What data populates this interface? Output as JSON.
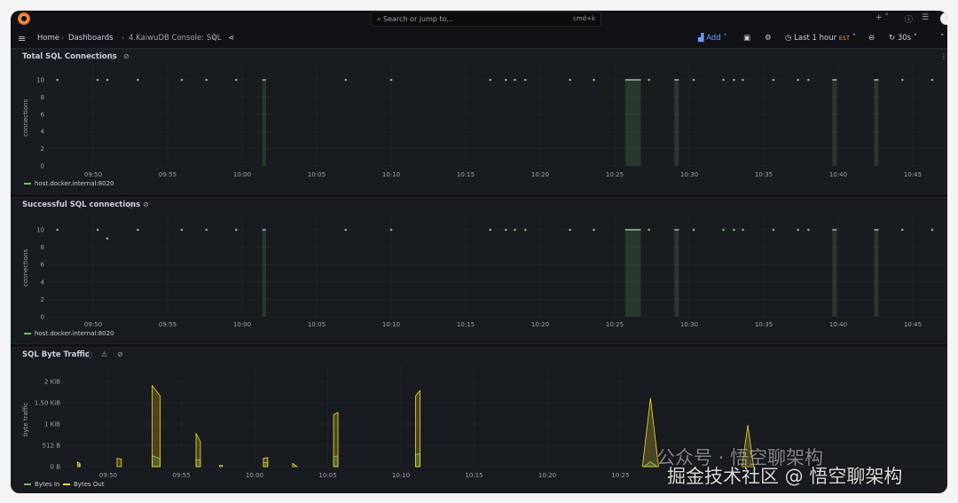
{
  "topbar": {
    "search_placeholder": "Search or jump to...",
    "shortcut": "cmd+k",
    "new_label": "+"
  },
  "breadcrumb": {
    "items": [
      "Home",
      "Dashboards",
      "4.KaiwuDB Console: SQL"
    ]
  },
  "toolbar": {
    "add_label": "Add",
    "time_range": "Last 1 hour",
    "timezone": "EST",
    "refresh": "30s"
  },
  "colors": {
    "bg": "#111217",
    "panel": "#181b1f",
    "series_green": "#73bf69",
    "series_yellow": "#fade2a",
    "timezone": "#f2a33a",
    "add": "#6e9fff"
  },
  "x_ticks": {
    "panel_a": [
      "09:50",
      "09:55",
      "10:00",
      "10:05",
      "10:10",
      "10:15",
      "10:20",
      "10:25",
      "10:30",
      "10:35",
      "10:40",
      "10:45"
    ],
    "panel_c": [
      "09:50",
      "09:55",
      "10:00",
      "10:05",
      "10:10",
      "10:15",
      "10:20",
      "10:25"
    ]
  },
  "panels": [
    {
      "title": "Total SQL Connections",
      "ylabel": "connections",
      "legend": [
        "host.docker.internal:8020"
      ]
    },
    {
      "title": "Successful SQL connections",
      "ylabel": "connections",
      "legend": [
        "host.docker.internal:8020"
      ]
    },
    {
      "title": "SQL Byte Traffic",
      "ylabel": "byte traffic",
      "legend": [
        "Bytes In",
        "Bytes Out"
      ]
    }
  ],
  "chart_data": [
    {
      "type": "scatter",
      "title": "Total SQL Connections",
      "x_unit": "minutes after 09:45",
      "ylabel": "connections",
      "yticks": [
        "0",
        "2",
        "4",
        "6",
        "8",
        "10"
      ],
      "ylim": [
        0,
        10
      ],
      "series": [
        {
          "name": "host.docker.internal:8020",
          "points": [
            [
              2.6,
              10
            ],
            [
              5.3,
              10
            ],
            [
              5.95,
              10
            ],
            [
              8,
              10
            ],
            [
              10.95,
              10
            ],
            [
              12.6,
              10
            ],
            [
              14.6,
              10
            ],
            [
              21.95,
              10
            ],
            [
              25,
              10
            ],
            [
              31.65,
              10
            ],
            [
              32.7,
              10
            ],
            [
              33.3,
              10
            ],
            [
              34,
              10
            ],
            [
              37,
              10
            ],
            [
              38.6,
              10
            ],
            [
              42.3,
              10
            ],
            [
              45.3,
              10
            ],
            [
              47.3,
              10
            ],
            [
              48,
              10
            ],
            [
              48.6,
              10
            ],
            [
              50.65,
              10
            ],
            [
              52.3,
              10
            ],
            [
              53,
              10
            ],
            [
              59.3,
              10
            ],
            [
              61.3,
              10
            ]
          ],
          "bands": [
            [
              16.35,
              16.6
            ],
            [
              40.7,
              41.75
            ],
            [
              44.0,
              44.3
            ],
            [
              54.6,
              54.9
            ],
            [
              57.4,
              57.7
            ]
          ]
        }
      ]
    },
    {
      "type": "scatter",
      "title": "Successful SQL connections",
      "x_unit": "minutes after 09:45",
      "ylabel": "connections",
      "yticks": [
        "0",
        "2",
        "4",
        "6",
        "8",
        "10"
      ],
      "ylim": [
        0,
        10
      ],
      "series": [
        {
          "name": "host.docker.internal:8020",
          "points": [
            [
              2.6,
              10
            ],
            [
              5.3,
              10
            ],
            [
              5.95,
              9
            ],
            [
              8,
              10
            ],
            [
              10.95,
              10
            ],
            [
              12.6,
              10
            ],
            [
              14.6,
              10
            ],
            [
              21.95,
              10
            ],
            [
              25,
              10
            ],
            [
              31.65,
              10
            ],
            [
              32.7,
              10
            ],
            [
              33.3,
              10
            ],
            [
              34,
              10
            ],
            [
              37,
              10
            ],
            [
              38.6,
              10
            ],
            [
              42.3,
              10
            ],
            [
              45.3,
              10
            ],
            [
              47.3,
              10
            ],
            [
              48,
              10
            ],
            [
              48.6,
              10
            ],
            [
              50.65,
              10
            ],
            [
              52.3,
              10
            ],
            [
              53,
              10
            ],
            [
              59.3,
              10
            ],
            [
              61.3,
              10
            ]
          ],
          "bands": [
            [
              16.35,
              16.6
            ],
            [
              40.7,
              41.75
            ],
            [
              44.0,
              44.3
            ],
            [
              54.6,
              54.9
            ],
            [
              57.4,
              57.7
            ]
          ]
        }
      ]
    },
    {
      "type": "area",
      "title": "SQL Byte Traffic",
      "x_unit": "minutes after 09:45",
      "ylabel": "byte traffic",
      "yticks": [
        "0 B",
        "512 B",
        "1 KiB",
        "1.50 KiB",
        "2 KiB"
      ],
      "ylim": [
        0,
        2048
      ],
      "series": [
        {
          "name": "Bytes In",
          "color": "#73bf69",
          "spikes": [
            [
              3.0,
              3.1,
              60,
              60
            ],
            [
              8.0,
              8.55,
              260,
              200
            ],
            [
              11.0,
              11.3,
              180,
              150
            ],
            [
              15.6,
              15.9,
              100,
              100
            ],
            [
              20.4,
              20.7,
              240,
              260
            ],
            [
              26.0,
              26.3,
              280,
              320
            ],
            [
              41.6,
              42.5,
              120,
              0
            ]
          ]
        },
        {
          "name": "Bytes Out",
          "color": "#fade2a",
          "spikes": [
            [
              2.9,
              3.05,
              110,
              80
            ],
            [
              5.6,
              5.9,
              200,
              180
            ],
            [
              8.0,
              8.55,
              1950,
              1700
            ],
            [
              11.0,
              11.3,
              800,
              600
            ],
            [
              12.6,
              12.8,
              30,
              30
            ],
            [
              15.6,
              15.9,
              200,
              220
            ],
            [
              17.6,
              17.9,
              80,
              0
            ],
            [
              20.4,
              20.7,
              1250,
              1300
            ],
            [
              26.0,
              26.3,
              1700,
              1830
            ],
            [
              41.5,
              42.6,
              1650,
              0
            ],
            [
              48.3,
              49.1,
              1000,
              0
            ]
          ]
        }
      ]
    }
  ],
  "watermark": {
    "line1": "公众号 · 悟空聊架构",
    "line2": "掘金技术社区 @ 悟空聊架构"
  }
}
